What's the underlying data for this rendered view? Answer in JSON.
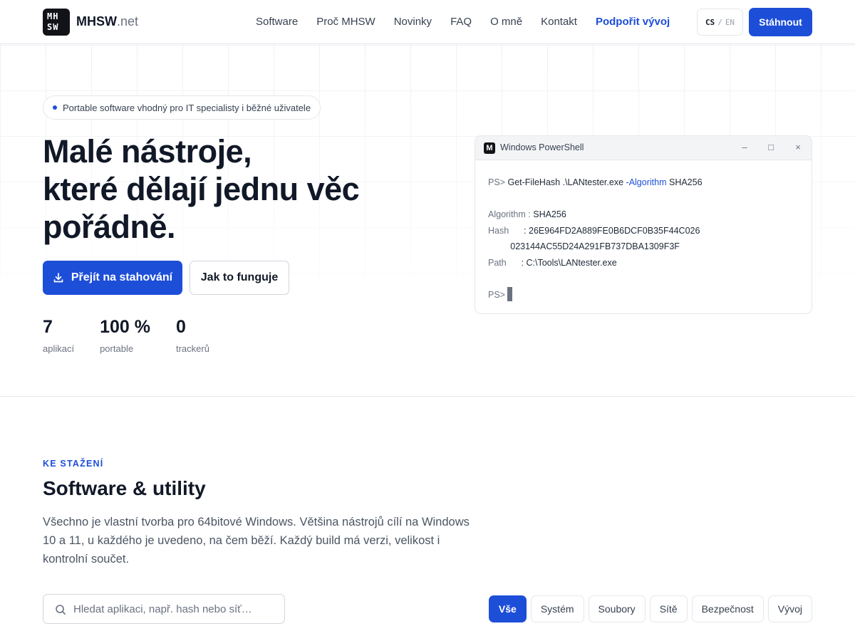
{
  "header": {
    "logo_lines": [
      "MH",
      "SW"
    ],
    "brand_name": "MHSW",
    "brand_tld": ".net",
    "nav": [
      "Software",
      "Proč MHSW",
      "Novinky",
      "FAQ",
      "O mně",
      "Kontakt"
    ],
    "nav_accent": "Podpořit vývoj",
    "lang_current": "CS",
    "lang_sep": "/",
    "lang_other": "EN",
    "download_label": "Stáhnout"
  },
  "hero": {
    "pill": "Portable software vhodný pro IT specialisty i běžné uživatele",
    "title_lines": [
      "Malé nástroje,",
      "které dělají jednu věc",
      "pořádně."
    ],
    "primary_button": "Přejít na stahování",
    "secondary_button": "Jak to funguje",
    "stats": [
      {
        "value": "7",
        "label": "aplikací"
      },
      {
        "value": "100 %",
        "label": "portable"
      },
      {
        "value": "0",
        "label": "trackerů"
      }
    ]
  },
  "terminal": {
    "title": "Windows PowerShell",
    "command_prompt": "PS>",
    "command": "Get-FileHash .\\LANtester.exe",
    "command_flag": "-Algorithm",
    "command_arg": "SHA256",
    "algorithm_key": "Algorithm :",
    "algorithm_value": "SHA256",
    "hash_key": "Hash",
    "hash_sep": ":",
    "hash_line1": "26E964FD2A889FE0B6DCF0B35F44C026",
    "hash_line2": "023144AC55D24A291FB737DBA1309F3F",
    "path_key": "Path",
    "path_value": ": C:\\Tools\\LANtester.exe",
    "final_prompt": "PS>"
  },
  "software_section": {
    "eyebrow": "KE STAŽENÍ",
    "title": "Software & utility",
    "description": "Všechno je vlastní tvorba pro 64bitové Windows. Většina nástrojů cílí na Windows 10 a 11, u každého je uvedeno, na čem běží. Každý build má verzi, velikost i kontrolní součet.",
    "search_placeholder": "Hledat aplikaci, např. hash nebo síť…",
    "filters": [
      "Vše",
      "Systém",
      "Soubory",
      "Sítě",
      "Bezpečnost",
      "Vývoj"
    ],
    "active_filter": "Vše"
  },
  "colors": {
    "accent": "#1d4ed8",
    "text": "#111827",
    "muted": "#6b7280"
  }
}
